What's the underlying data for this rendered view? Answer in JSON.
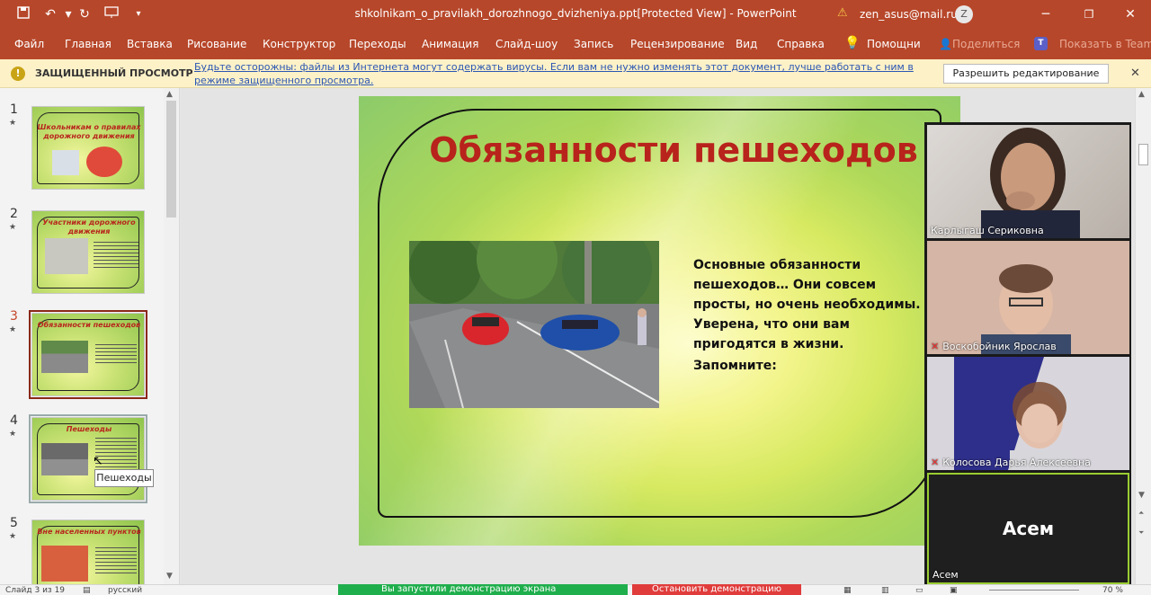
{
  "window": {
    "title": "shkolnikam_o_pravilakh_dorozhnogo_dvizheniya.ppt[Protected View]  -  PowerPoint",
    "account": "zen_asus@mail.ru",
    "avatar_letter": "Z",
    "icons": [
      "save-icon",
      "undo-icon",
      "redo-icon",
      "present-icon",
      "customize-icon",
      "warning-icon",
      "minimize-icon",
      "restore-icon",
      "close-icon"
    ]
  },
  "menu": {
    "items": [
      "Файл",
      "Главная",
      "Вставка",
      "Рисование",
      "Конструктор",
      "Переходы",
      "Анимация",
      "Слайд-шоу",
      "Запись",
      "Рецензирование",
      "Вид",
      "Справка"
    ],
    "help": "Помощни",
    "share": "Поделиться",
    "teams": "Показать в Teams"
  },
  "protected_view": {
    "title": "ЗАЩИЩЕННЫЙ ПРОСМОТР",
    "message": "Будьте осторожны: файлы из Интернета могут содержать вирусы. Если вам не нужно изменять этот документ, лучше работать с ним в режиме защищенного просмотра.",
    "enable_button": "Разрешить редактирование",
    "accent_color": "#fdf1c8"
  },
  "thumbnails": [
    {
      "num": "1",
      "title": "Школьникам о правилах дорожного движения"
    },
    {
      "num": "2",
      "title": "Участники дорожного движения"
    },
    {
      "num": "3",
      "title": "Обязанности пешеходов"
    },
    {
      "num": "4",
      "title": "Пешеходы"
    },
    {
      "num": "5",
      "title": "Вне населенных пунктов"
    }
  ],
  "tooltip": "Пешеходы",
  "slide": {
    "title": "Обязанности пешеходов",
    "body": "Основные обязанности пешеходов… Они совсем просты, но очень необходимы. Уверена, что они вам пригодятся в жизни.",
    "remember": "Запомните:",
    "title_color": "#b8231c"
  },
  "participants": [
    {
      "name": "Карлыгаш Сериковна",
      "muted": false
    },
    {
      "name": "Воскобойник Ярослав",
      "muted": true
    },
    {
      "name": "Колосова Дарья Алексеевна",
      "muted": true
    },
    {
      "name": "Асем",
      "muted": false,
      "placeholder": "Асем"
    }
  ],
  "status": {
    "slide_info": "Слайд 3 из 19",
    "language": "русский",
    "sharing_banner": "Вы запустили демонстрацию экрана",
    "stop_sharing": "Остановить демонстрацию",
    "zoom": "70 %"
  }
}
